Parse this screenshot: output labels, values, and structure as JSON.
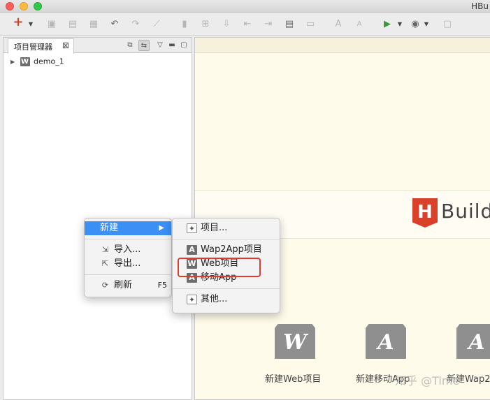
{
  "window": {
    "title": "HBu"
  },
  "toolbar": {
    "add_symbol": "+"
  },
  "project_panel": {
    "tab_label": "项目管理器",
    "tree": [
      {
        "label": "demo_1",
        "badge": "W"
      }
    ]
  },
  "context_menu": {
    "items": [
      {
        "label": "新建",
        "arrow": "▶"
      },
      {
        "label": "导入..."
      },
      {
        "label": "导出..."
      },
      {
        "label": "刷新",
        "shortcut": "F5"
      }
    ]
  },
  "submenu": {
    "items": [
      {
        "label": "项目..."
      },
      {
        "label": "Wap2App项目",
        "badge": "A"
      },
      {
        "label": "Web项目",
        "badge": "W"
      },
      {
        "label": "移动App",
        "badge": "A"
      },
      {
        "label": "其他..."
      }
    ]
  },
  "editor": {
    "logo_letter": "H",
    "logo_text": "Builde",
    "shortcuts": [
      {
        "glyph": "W",
        "label": "新建Web项目"
      },
      {
        "glyph": "A",
        "label": "新建移动App"
      },
      {
        "glyph": "A",
        "label": "新建Wap2"
      }
    ],
    "watermark": "知乎 @Time"
  },
  "colors": {
    "menu_highlight": "#3b8ff5",
    "annotation_box": "#e23b2e",
    "logo": "#d9412b"
  }
}
